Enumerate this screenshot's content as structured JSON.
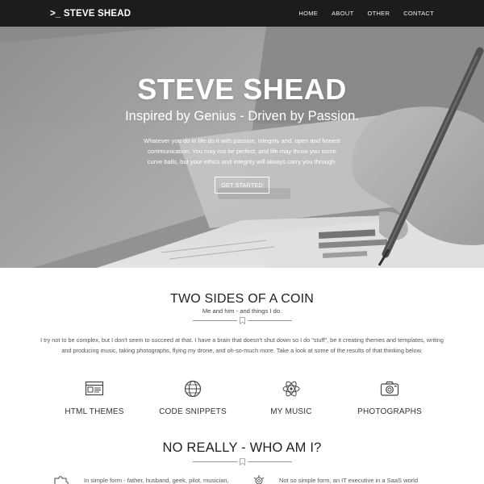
{
  "nav": {
    "brand": ">_ STEVE SHEAD",
    "links": [
      "HOME",
      "ABOUT",
      "OTHER",
      "CONTACT"
    ]
  },
  "hero": {
    "title": "STEVE SHEAD",
    "subtitle": "Inspired by Genius - Driven by Passion.",
    "text": "Whatever you do in life do it with passion, integrity and, open and honest communication. You may not be perfect, and life may throw you some curve balls, but your ethics and integrity will always carry you through.",
    "button": "GET STARTED"
  },
  "coin": {
    "title": "TWO SIDES OF A COIN",
    "subtitle": "Me and him - and things I do.",
    "text": "I try not to be complex, but I don't seem to succeed at that. I have a brain that doesn't shut down so I do \"stuff\", be it creating themes and templates, writing and producing music, taking photographs, flying my drone, and oh-so-much more. Take a look at some of the results of that thinking below."
  },
  "features": [
    {
      "label": "HTML THEMES",
      "icon": "browser-window-icon"
    },
    {
      "label": "CODE SNIPPETS",
      "icon": "globe-icon"
    },
    {
      "label": "MY MUSIC",
      "icon": "atom-icon"
    },
    {
      "label": "PHOTOGRAPHS",
      "icon": "camera-icon"
    }
  ],
  "who": {
    "title": "NO REALLY - WHO AM I?",
    "left_text": "In simple form - father, husband, geek, pilot, musician,",
    "right_text": "Not so simple form, an IT executive in a SaaS world"
  },
  "colors": {
    "nav_bg": "#1c1c1c",
    "text_dark": "#222222"
  }
}
